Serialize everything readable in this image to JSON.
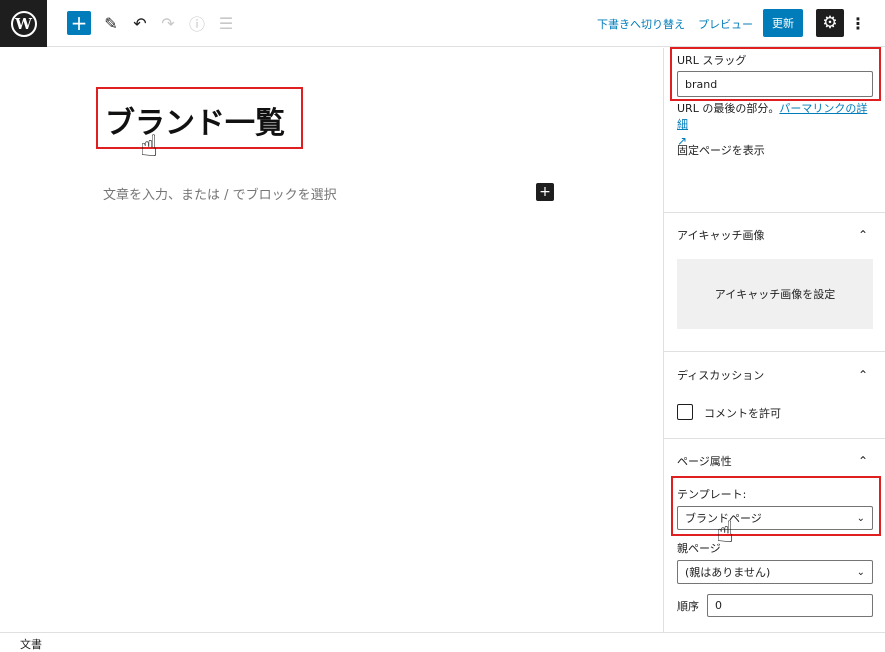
{
  "topbar": {
    "logo_letter": "W",
    "add_icon": "+",
    "edit_icon": "✎",
    "undo_icon": "↶",
    "redo_icon": "↷",
    "info_icon": "ⓘ",
    "list_icon": "☰",
    "save_draft_label": "下書きへ切り替え",
    "preview_label": "プレビュー",
    "update_label": "更新",
    "settings_icon": "⚙",
    "more_icon": "⋮"
  },
  "editor": {
    "title": "ブランド一覧",
    "placeholder": "文章を入力、または / でブロックを選択",
    "block_add_icon": "+"
  },
  "sidebar": {
    "url_slug_label": "URL スラッグ",
    "url_slug_value": "brand",
    "url_help_text": "URL の最後の部分。",
    "permalink_link": "パーマリンクの詳細",
    "external_icon": "↗",
    "view_page_link": "固定ページを表示",
    "featured_image_title": "アイキャッチ画像",
    "featured_image_button": "アイキャッチ画像を設定",
    "discussion_title": "ディスカッション",
    "allow_comments_label": "コメントを許可",
    "page_attributes_title": "ページ属性",
    "template_label": "テンプレート:",
    "template_value": "ブランドページ",
    "parent_label": "親ページ",
    "parent_value": "(親はありません)",
    "order_label": "順序",
    "order_value": "0",
    "chevron_up": "⌃",
    "chevron_down": "⌄"
  },
  "footer": {
    "breadcrumb": "文書"
  },
  "annotations": {
    "hand_pointer": "☝"
  },
  "colors": {
    "accent": "#007cba",
    "highlight": "#e02020",
    "dark": "#1e1e1e"
  }
}
